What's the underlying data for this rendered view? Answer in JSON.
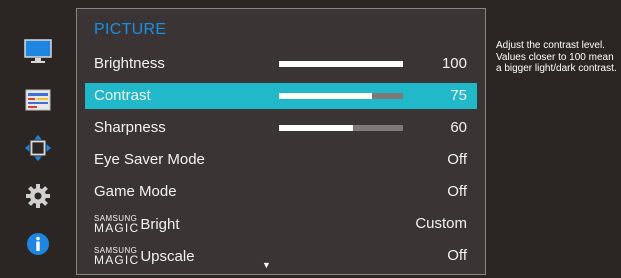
{
  "menu": {
    "title": "PICTURE",
    "rows": [
      {
        "label": "Brightness",
        "value": "100",
        "level": 1.0,
        "selected": false
      },
      {
        "label": "Contrast",
        "value": "75",
        "level": 0.75,
        "selected": true
      },
      {
        "label": "Sharpness",
        "value": "60",
        "level": 0.6,
        "selected": false
      },
      {
        "label": "Eye Saver Mode",
        "value": "Off",
        "selected": false
      },
      {
        "label": "Game Mode",
        "value": "Off",
        "selected": false
      },
      {
        "magic_top": "SAMSUNG",
        "magic_bottom": "MAGIC",
        "label_suffix": "Bright",
        "value": "Custom",
        "selected": false
      },
      {
        "magic_top": "SAMSUNG",
        "magic_bottom": "MAGIC",
        "label_suffix": "Upscale",
        "value": "Off",
        "selected": false
      }
    ],
    "scroll_glyph": "▼"
  },
  "help": {
    "text": "Adjust the contrast level. Values closer to 100 mean a bigger light/dark contrast."
  },
  "sidebar": {
    "icons": [
      "monitor-icon",
      "color-bars-icon",
      "resize-arrows-icon",
      "gear-icon",
      "info-icon"
    ]
  },
  "colors": {
    "background": "#2b2624",
    "panel": "#3a3534",
    "accent_title": "#1a8fe6",
    "selected_row": "#21b9c9",
    "slider_fill": "#ffffff",
    "slider_track": "#7d7977"
  }
}
